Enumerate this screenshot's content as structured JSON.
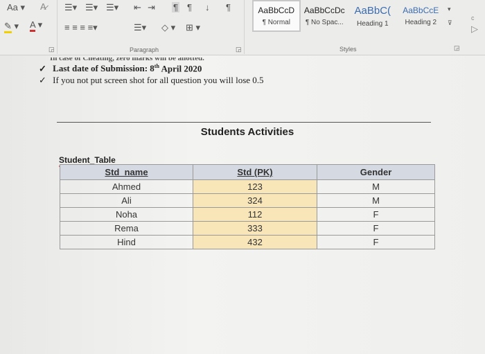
{
  "ribbon": {
    "font_case_label": "Aa",
    "paragraph_group_label": "Paragraph",
    "styles_group_label": "Styles",
    "styles": [
      {
        "preview": "AaBbCcD",
        "label": "¶ Normal",
        "selected": true
      },
      {
        "preview": "AaBbCcDc",
        "label": "¶ No Spac...",
        "selected": false
      },
      {
        "preview": "AaBbC(",
        "label": "Heading 1",
        "selected": false
      },
      {
        "preview": "AaBbCcE",
        "label": "Heading 2",
        "selected": false
      }
    ],
    "colors": {
      "highlight": "#f0d000",
      "font_color": "#d03030"
    }
  },
  "document": {
    "cut_line": "In case of Cheating, zero marks will be allotted.",
    "bullets": [
      {
        "check": "✓",
        "text": "Last date of Submission: 8",
        "sup": "th",
        "rest": " April 2020",
        "bold": true
      },
      {
        "check": "✓",
        "text": "If you not put screen shot for all question you will lose 0.5"
      }
    ],
    "title": "Students Activities",
    "table_caption": "Student_Table",
    "table": {
      "headers": [
        "Std_name",
        "Std (PK)",
        "Gender"
      ],
      "rows": [
        [
          "Ahmed",
          "123",
          "M"
        ],
        [
          "Ali",
          "324",
          "M"
        ],
        [
          "Noha",
          "112",
          "F"
        ],
        [
          "Rema",
          "333",
          "F"
        ],
        [
          "Hind",
          "432",
          "F"
        ]
      ]
    }
  }
}
